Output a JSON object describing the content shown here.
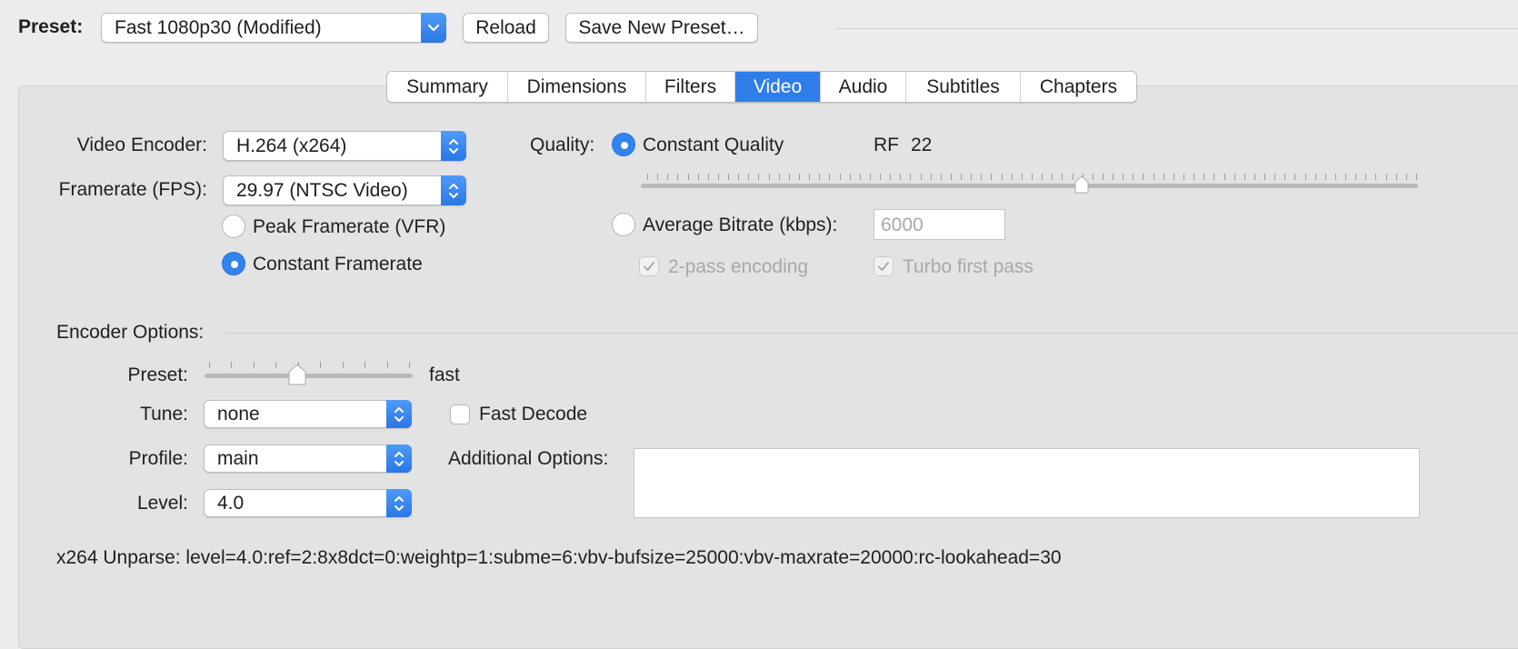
{
  "topbar": {
    "preset_label": "Preset:",
    "preset_value": "Fast 1080p30 (Modified)",
    "reload_label": "Reload",
    "save_new_label": "Save New Preset…"
  },
  "tabs": [
    "Summary",
    "Dimensions",
    "Filters",
    "Video",
    "Audio",
    "Subtitles",
    "Chapters"
  ],
  "active_tab": "Video",
  "video": {
    "encoder_label": "Video Encoder:",
    "encoder_value": "H.264 (x264)",
    "framerate_label": "Framerate (FPS):",
    "framerate_value": "29.97 (NTSC Video)",
    "peak_framerate_label": "Peak Framerate (VFR)",
    "constant_framerate_label": "Constant Framerate",
    "framerate_mode": "constant"
  },
  "quality": {
    "label": "Quality:",
    "constant_quality_label": "Constant Quality",
    "rf_label": "RF",
    "rf_value": "22",
    "rf_slider_fraction": 0.567,
    "avg_bitrate_label": "Average Bitrate (kbps):",
    "avg_bitrate_placeholder": "6000",
    "two_pass_label": "2-pass encoding",
    "turbo_label": "Turbo first pass",
    "mode": "constant_quality"
  },
  "encoder_options": {
    "section_label": "Encoder Options:",
    "preset_label": "Preset:",
    "preset_value": "fast",
    "preset_slider_fraction": 0.445,
    "tune_label": "Tune:",
    "tune_value": "none",
    "fast_decode_label": "Fast Decode",
    "profile_label": "Profile:",
    "profile_value": "main",
    "additional_label": "Additional Options:",
    "level_label": "Level:",
    "level_value": "4.0"
  },
  "unparse": "x264 Unparse: level=4.0:ref=2:8x8dct=0:weightp=1:subme=6:vbv-bufsize=25000:vbv-maxrate=20000:rc-lookahead=30",
  "colors": {
    "accent": "#2f7de8",
    "panel": "#e3e3e3",
    "background": "#ececec"
  }
}
